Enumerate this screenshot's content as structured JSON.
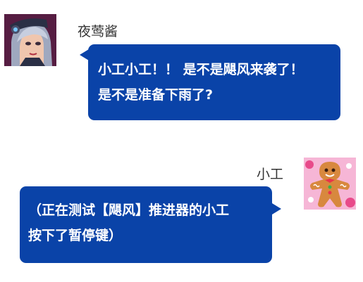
{
  "messages": [
    {
      "sender": "夜莺酱",
      "avatar_icon": "armored-woman-avatar",
      "side": "left",
      "lines": [
        "小工小工！！ 是不是飓风来袭了！",
        "是不是准备下雨了?"
      ]
    },
    {
      "sender": "小工",
      "avatar_icon": "gingerbread-man-avatar",
      "side": "right",
      "lines": [
        "（正在测试【飓风】推进器的小工",
        "按下了暂停键）"
      ]
    }
  ],
  "colors": {
    "bubble": "#0a43a8",
    "bubble_text": "#ffffff",
    "name_text": "#333333",
    "background": "#ffffff"
  }
}
